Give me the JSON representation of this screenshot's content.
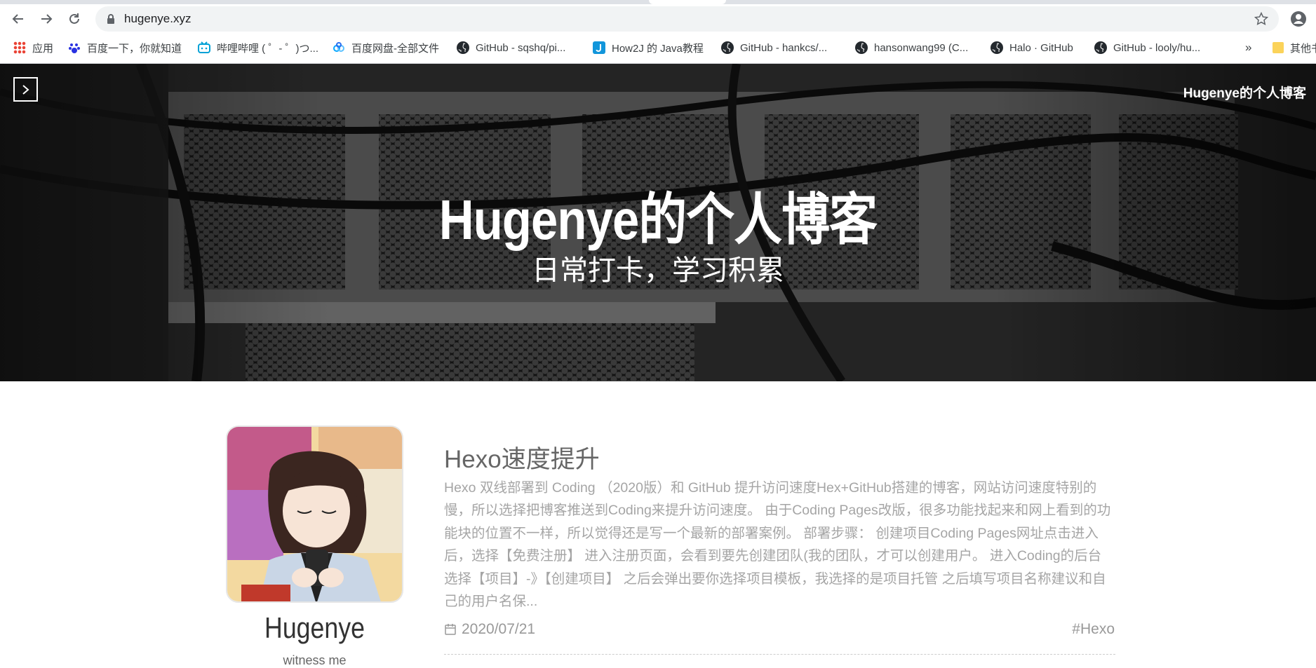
{
  "browser": {
    "url": "hugenye.xyz",
    "icons": {
      "back": "back-arrow-icon",
      "forward": "forward-arrow-icon",
      "reload": "reload-icon",
      "lock": "lock-icon",
      "star": "star-icon",
      "profile": "profile-icon"
    },
    "bookmarks": [
      {
        "label": "应用",
        "icon": "apps-grid-icon"
      },
      {
        "label": "百度一下，你就知道",
        "icon": "baidu-icon"
      },
      {
        "label": "哔哩哔哩 ( ゜- ゜)つ...",
        "icon": "bilibili-icon"
      },
      {
        "label": "百度网盘-全部文件",
        "icon": "baidu-netdisk-icon"
      },
      {
        "label": "GitHub - sqshq/pi...",
        "icon": "github-icon"
      },
      {
        "label": "How2J 的 Java教程",
        "icon": "how2j-icon"
      },
      {
        "label": "GitHub - hankcs/...",
        "icon": "github-icon"
      },
      {
        "label": "hansonwang99 (C...",
        "icon": "github-icon"
      },
      {
        "label": "Halo · GitHub",
        "icon": "github-icon"
      },
      {
        "label": "GitHub - looly/hu...",
        "icon": "github-icon"
      }
    ],
    "more": "»",
    "other_bookmarks": "其他书"
  },
  "hero": {
    "brand": "Hugenye的个人博客",
    "title": "Hugenye的个人博客",
    "subtitle": "日常打卡，学习积累"
  },
  "sidebar": {
    "author": "Hugenye",
    "bio": "witness me"
  },
  "post": {
    "title": "Hexo速度提升",
    "excerpt": "Hexo 双线部署到 Coding （2020版）和 GitHub 提升访问速度Hex+GitHub搭建的博客，网站访问速度特别的慢，所以选择把博客推送到Coding来提升访问速度。 由于Coding Pages改版，很多功能找起来和网上看到的功能块的位置不一样，所以觉得还是写一个最新的部署案例。 部署步骤： 创建项目Coding Pages网址点击进入后，选择【免费注册】 进入注册页面，会看到要先创建团队(我的团队，才可以创建用户。 进入Coding的后台 选择【项目】-》【创建项目】 之后会弹出要你选择项目模板，我选择的是项目托管 之后填写项目名称建议和自己的用户名保...",
    "date": "2020/07/21",
    "tag": "#Hexo"
  }
}
